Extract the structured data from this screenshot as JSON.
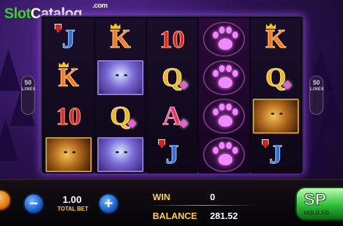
{
  "brand": {
    "slot": "Slot",
    "catalog": "Catalog",
    "com": ".com"
  },
  "paylines": {
    "left": {
      "value": "50",
      "word": "LINES"
    },
    "right": {
      "value": "50",
      "word": "LINES"
    }
  },
  "reels": [
    [
      "J",
      "K",
      "10",
      "lion"
    ],
    [
      "K",
      "leopard",
      "Q",
      "leopard"
    ],
    [
      "10",
      "Q",
      "A",
      "J"
    ],
    [
      "paw",
      "paw",
      "paw",
      "paw"
    ],
    [
      "K",
      "Q",
      "lion",
      "J"
    ]
  ],
  "controls": {
    "total_bet_value": "1.00",
    "total_bet_label": "TOTAL BET",
    "win_label": "WIN",
    "win_value": "0",
    "balance_label": "BALANCE",
    "balance_value": "281.52",
    "spin_label": "SP",
    "spin_sub": "HOLD FO",
    "minus_icon": "−",
    "plus_icon": "+"
  },
  "colors": {
    "accent": "#ffcf3a",
    "spin_green": "#2fbf3a",
    "paw_glow": "#f088ff",
    "frame_glow": "#8a4be0"
  }
}
